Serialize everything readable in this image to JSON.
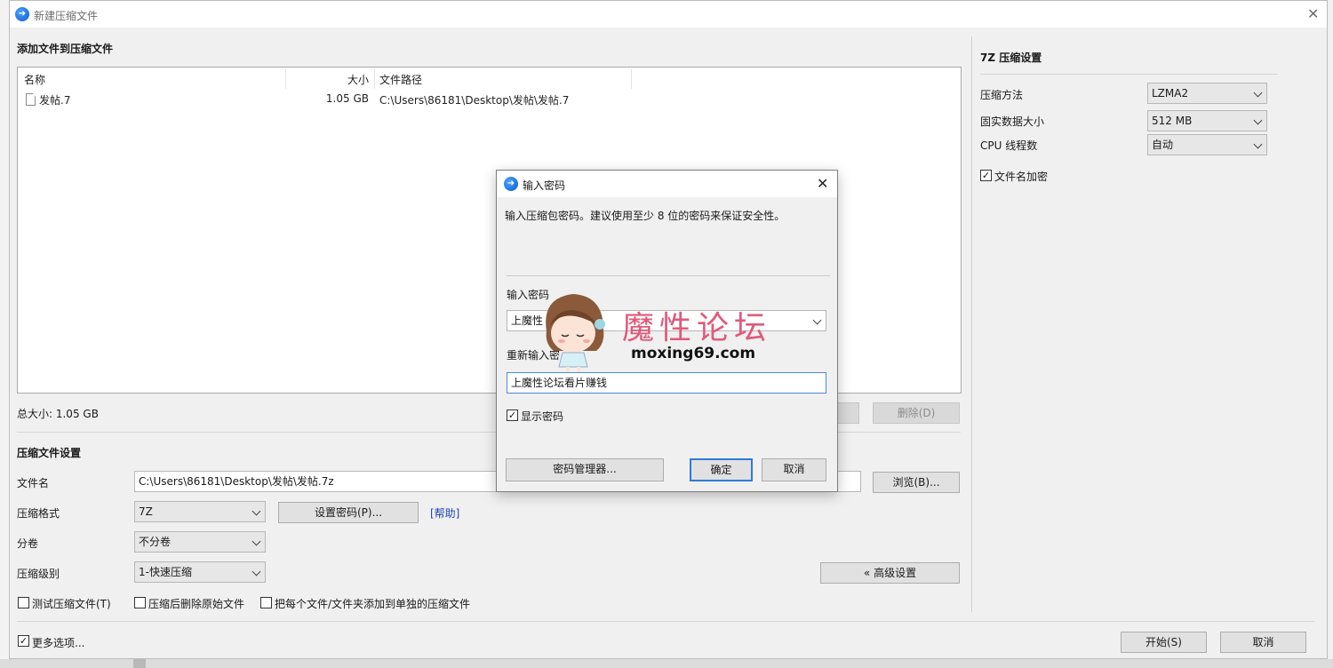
{
  "window": {
    "title": "新建压缩文件"
  },
  "add_files": {
    "section_title": "添加文件到压缩文件",
    "columns": [
      "名称",
      "大小",
      "文件路径"
    ],
    "rows": [
      {
        "name": "发帖.7",
        "size": "1.05 GB",
        "path": "C:\\Users\\86181\\Desktop\\发帖\\发帖.7"
      }
    ],
    "total_label": "总大小: 1.05 GB",
    "delete_button": "删除(D)"
  },
  "settings": {
    "section_title": "压缩文件设置",
    "filename_label": "文件名",
    "filename_value": "C:\\Users\\86181\\Desktop\\发帖\\发帖.7z",
    "browse_button": "浏览(B)...",
    "format_label": "压缩格式",
    "format_value": "7Z",
    "set_password_button": "设置密码(P)...",
    "help_link": "[帮助]",
    "volume_label": "分卷",
    "volume_value": "不分卷",
    "level_label": "压缩级别",
    "level_value": "1-快速压缩",
    "advanced_button": "« 高级设置",
    "check_test": "测试压缩文件(T)",
    "check_delete": "压缩后删除原始文件",
    "check_separate": "把每个文件/文件夹添加到单独的压缩文件",
    "more_options": "更多选项..."
  },
  "footer": {
    "start_button": "开始(S)",
    "cancel_button": "取消"
  },
  "right_panel": {
    "title": "7Z 压缩设置",
    "method_label": "压缩方法",
    "method_value": "LZMA2",
    "solid_label": "固实数据大小",
    "solid_value": "512 MB",
    "threads_label": "CPU 线程数",
    "threads_value": "自动",
    "encrypt_names": "文件名加密"
  },
  "dialog": {
    "title": "输入密码",
    "description": "输入压缩包密码。建议使用至少 8 位的密码来保证安全性。",
    "password_label": "输入密码",
    "password_value": "上魔性",
    "reenter_label": "重新输入密",
    "reenter_value": "上魔性论坛看片赚钱",
    "show_password": "显示密码",
    "manager_button": "密码管理器...",
    "ok_button": "确定",
    "cancel_button": "取消"
  },
  "watermark": {
    "title": "魔性论坛",
    "url": "moxing69.com"
  }
}
